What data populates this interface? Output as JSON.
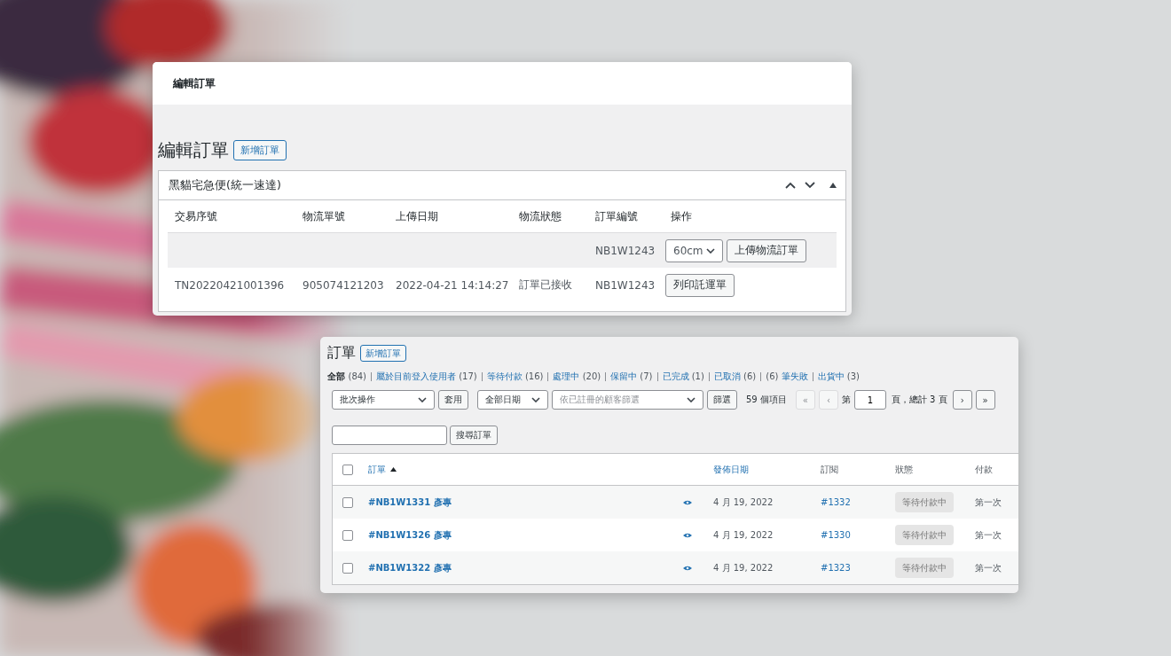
{
  "edit_panel": {
    "header_title": "編輯訂單",
    "heading": "編輯訂單",
    "add_button": "新增訂單",
    "box": {
      "title": "黑貓宅急便(統一速達)",
      "columns": [
        "交易序號",
        "物流單號",
        "上傳日期",
        "物流狀態",
        "訂單編號",
        "操作"
      ],
      "rows": [
        {
          "order_no": "NB1W1243",
          "actions": [
            {
              "kind": "select",
              "value": "60cm"
            },
            {
              "kind": "button",
              "label": "上傳物流訂單"
            }
          ]
        },
        {
          "transaction_no": "TN20220421001396",
          "tracking_no": "905074121203",
          "upload_date": "2022-04-21 14:14:27",
          "status": "訂單已接收",
          "order_no": "NB1W1243",
          "actions": [
            {
              "kind": "button",
              "label": "列印託運單"
            }
          ]
        }
      ]
    }
  },
  "orders_panel": {
    "heading": "訂單",
    "add_button": "新增訂單",
    "filters": [
      {
        "kind": "label_first",
        "label": "全部",
        "count": "(84)",
        "selected": true
      },
      {
        "kind": "label_first",
        "label": "屬於目前登入使用者",
        "count": "(17)",
        "selected": false
      },
      {
        "kind": "label_first",
        "label": "等待付款",
        "count": "(16)",
        "selected": false
      },
      {
        "kind": "label_first",
        "label": "處理中",
        "count": "(20)",
        "selected": false
      },
      {
        "kind": "label_first",
        "label": "保留中",
        "count": "(7)",
        "selected": false
      },
      {
        "kind": "label_first",
        "label": "已完成",
        "count": "(1)",
        "selected": false
      },
      {
        "kind": "label_first",
        "label": "已取消",
        "count": "(6)",
        "selected": false
      },
      {
        "kind": "count_first",
        "label": "筆失敗",
        "count": "(6)",
        "selected": false
      },
      {
        "kind": "label_first",
        "label": "出貨中",
        "count": "(3)",
        "selected": false
      }
    ],
    "bulk_select": "批次操作",
    "apply_button": "套用",
    "date_select": "全部日期",
    "customer_select": {
      "placeholder": "依已註冊的顧客篩選"
    },
    "filter_button": "篩選",
    "items_count": "59 個項目",
    "pagination": {
      "first": {
        "label": "«",
        "disabled": true
      },
      "prev": {
        "label": "‹",
        "disabled": true
      },
      "page_prefix": "第",
      "page": "1",
      "page_suffix": "頁，總計 3 頁",
      "next": {
        "label": "›",
        "disabled": false
      },
      "last": {
        "label": "»",
        "disabled": false
      }
    },
    "search_button": "搜尋訂單",
    "table": {
      "select_all": {
        "checked": false
      },
      "columns": [
        {
          "label": "訂單",
          "kind": "link",
          "sorted": true
        },
        {
          "label": "發佈日期",
          "kind": "link",
          "sorted": false
        },
        {
          "label": "訂閱",
          "kind": "plain",
          "sorted": false
        },
        {
          "label": "狀態",
          "kind": "plain",
          "sorted": false
        },
        {
          "label": "付款",
          "kind": "plain",
          "sorted": false
        }
      ],
      "rows": [
        {
          "checked": false,
          "order": "#NB1W1331 彥專",
          "date": "4 月 19, 2022",
          "subscription": "#1332",
          "status": "等待付款中",
          "payment": "第一次"
        },
        {
          "checked": false,
          "order": "#NB1W1326 彥專",
          "date": "4 月 19, 2022",
          "subscription": "#1330",
          "status": "等待付款中",
          "payment": "第一次"
        },
        {
          "checked": false,
          "order": "#NB1W1322 彥專",
          "date": "4 月 19, 2022",
          "subscription": "#1323",
          "status": "等待付款中",
          "payment": "第一次"
        }
      ]
    }
  }
}
